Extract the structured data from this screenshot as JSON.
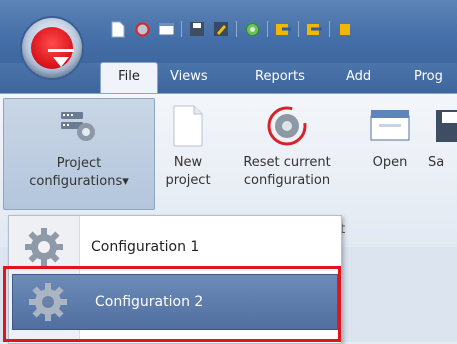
{
  "ribbon_tabs": [
    {
      "label": "File",
      "active": true
    },
    {
      "label": "Views",
      "active": false
    },
    {
      "label": "Reports",
      "active": false
    },
    {
      "label": "Add",
      "active": false
    },
    {
      "label": "Prog",
      "active": false
    }
  ],
  "quick_access": [
    "new-icon",
    "reset-icon",
    "open-icon",
    "save-icon",
    "edit-icon",
    "refresh-icon",
    "import-icon",
    "export-icon",
    "next-icon"
  ],
  "ribbon_buttons": {
    "project_configurations": {
      "line1": "Project",
      "line2": "configurations",
      "dropdown": "▾"
    },
    "new_project": {
      "line1": "New",
      "line2": "project"
    },
    "reset_configuration": {
      "line1": "Reset current",
      "line2": "configuration"
    },
    "open": {
      "line1": "Open"
    },
    "save": {
      "line1": "Sa"
    }
  },
  "group_label": "ect",
  "menu": {
    "items": [
      {
        "label": "Configuration 1",
        "selected": false
      },
      {
        "label": "Configuration 2",
        "selected": true
      }
    ]
  },
  "colors": {
    "accent": "#4a71a8",
    "highlight": "#e0141a",
    "selected_item": "#5a79a9"
  }
}
